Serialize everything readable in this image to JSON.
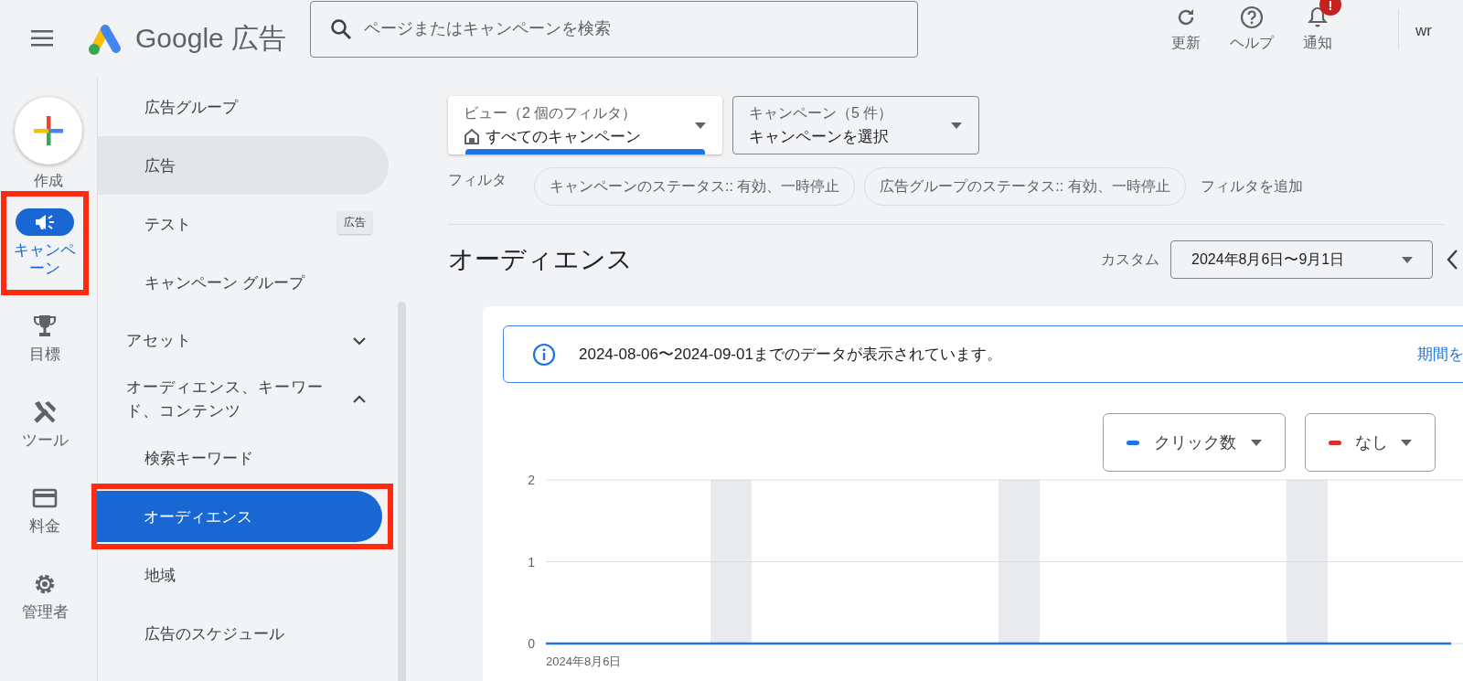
{
  "header": {
    "product": "Google 広告",
    "search": {
      "placeholder": "ページまたはキャンペーンを検索"
    },
    "actions": [
      {
        "label": "更新",
        "kind": "refresh"
      },
      {
        "label": "ヘルプ",
        "kind": "help"
      },
      {
        "label": "通知",
        "kind": "notifications",
        "badge": "!"
      }
    ],
    "account": "wr"
  },
  "rail": {
    "create": {
      "label": "作成"
    },
    "items": [
      {
        "label": "キャンペーン",
        "kind": "campaign",
        "selected": true,
        "highlighted": true
      },
      {
        "label": "目標",
        "kind": "goals",
        "selected": false,
        "highlighted": false
      },
      {
        "label": "ツール",
        "kind": "tools",
        "selected": false,
        "highlighted": false
      },
      {
        "label": "料金",
        "kind": "billing",
        "selected": false,
        "highlighted": false
      },
      {
        "label": "管理者",
        "kind": "admin",
        "selected": false,
        "highlighted": false
      }
    ]
  },
  "submenu": {
    "tooltip": "広告",
    "items": [
      {
        "label": "広告グループ",
        "kind": "link",
        "selected": false,
        "hovered": false,
        "highlighted": false
      },
      {
        "label": "広告",
        "kind": "link",
        "selected": false,
        "hovered": true,
        "highlighted": false
      },
      {
        "label": "テスト",
        "kind": "link",
        "selected": false,
        "hovered": false,
        "highlighted": false
      },
      {
        "label": "キャンペーン グループ",
        "kind": "link",
        "selected": false,
        "hovered": false,
        "highlighted": false
      },
      {
        "label": "アセット",
        "kind": "section",
        "expanded": false
      },
      {
        "label": "オーディエンス、キーワード、コンテンツ",
        "kind": "section",
        "expanded": true,
        "children": [
          {
            "label": "検索キーワード",
            "kind": "link",
            "selected": false,
            "hovered": false,
            "highlighted": false
          },
          {
            "label": "オーディエンス",
            "kind": "link",
            "selected": true,
            "hovered": false,
            "highlighted": true
          },
          {
            "label": "地域",
            "kind": "link",
            "selected": false,
            "hovered": false,
            "highlighted": false
          },
          {
            "label": "広告のスケジュール",
            "kind": "link",
            "selected": false,
            "hovered": false,
            "highlighted": false
          }
        ]
      }
    ]
  },
  "filters": {
    "view": {
      "label": "ビュー（2 個のフィルタ）",
      "value": "すべてのキャンペーン"
    },
    "campaign": {
      "label": "キャンペーン（5 件）",
      "value": "キャンペーンを選択"
    },
    "label": "フィルタ",
    "chips": [
      "キャンペーンのステータス:: 有効、一時停止",
      "広告グループのステータス:: 有効、一時停止"
    ],
    "add": "フィルタを追加"
  },
  "page": {
    "title": "オーディエンス",
    "range_label": "カスタム",
    "range": "2024年8月6日〜9月1日"
  },
  "card": {
    "notice": {
      "text": "2024-08-06〜2024-09-01までのデータが表示されています。",
      "link": "期間を"
    },
    "metrics": [
      {
        "color": "#1a73e8"
      },
      {
        "label": "なし",
        "color": "#d93025"
      }
    ],
    "x_axis_start": "2024年8月6日",
    "chart_data": {
      "type": "line",
      "ylim": [
        0,
        2
      ],
      "yticks": [
        0,
        1,
        2
      ],
      "series": [
        {
          "name": "クリック数",
          "color": "#1a73e8",
          "values": [
            0,
            0,
            0,
            0,
            0,
            0,
            0,
            0,
            0,
            0,
            0,
            0,
            0,
            0,
            0,
            0,
            0,
            0,
            0,
            0,
            0,
            0,
            0
          ]
        }
      ]
    }
  }
}
